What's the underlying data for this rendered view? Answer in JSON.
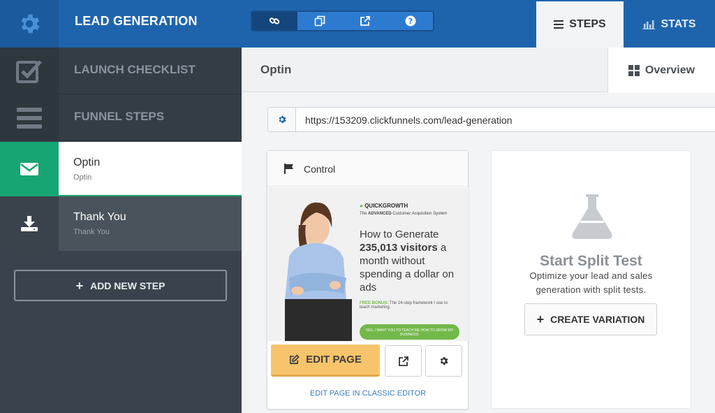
{
  "header": {
    "title": "LEAD GENERATION",
    "tabs": {
      "steps": "STEPS",
      "stats": "STATS"
    }
  },
  "toolbar": {
    "icons": [
      "link-icon",
      "copy-icon",
      "external-link-icon",
      "help-icon"
    ]
  },
  "sidebar": {
    "launch_checklist": "LAUNCH CHECKLIST",
    "funnel_steps": "FUNNEL STEPS",
    "steps": [
      {
        "title": "Optin",
        "subtitle": "Optin"
      },
      {
        "title": "Thank You",
        "subtitle": "Thank You"
      }
    ],
    "add_step": "ADD NEW STEP"
  },
  "main": {
    "title": "Optin",
    "overview_tab": "Overview",
    "url": "https://153209.clickfunnels.com/lead-generation"
  },
  "control_card": {
    "label": "Control",
    "preview": {
      "brand": "QUICKGROWTH",
      "tag_pre": "The ",
      "tag_em": "ADVANCED",
      "tag_post": " Customer Acquisition System",
      "headline_1": "How to Generate ",
      "headline_bold": "235,013 visitors",
      "headline_2": " a month without spending a dollar on ads",
      "bonus_label": "FREE BONUS:",
      "bonus_text": " The 24-step framework I use to teach marketing.",
      "cta": "YES, I WANT YOU TO TEACH ME HOW TO GROW MY BUSINESS!"
    },
    "edit_button": "EDIT PAGE",
    "classic_link": "EDIT PAGE IN CLASSIC EDITOR"
  },
  "split_test": {
    "title": "Start Split Test",
    "subtitle": "Optimize your lead and sales generation with split tests.",
    "button": "CREATE VARIATION"
  },
  "colors": {
    "primary": "#1e64ad",
    "accent_green": "#17a673",
    "edit_orange": "#f8c46b"
  }
}
